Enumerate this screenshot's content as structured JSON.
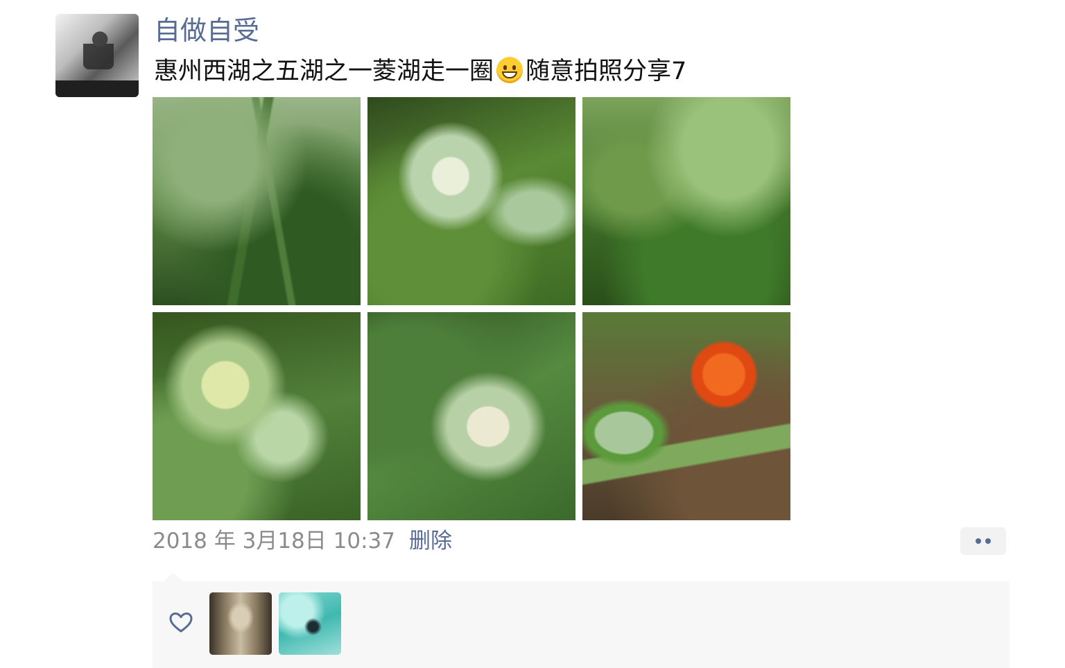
{
  "post": {
    "username": "自做自受",
    "text_before_emoji": "惠州西湖之五湖之一菱湖走一圈",
    "emoji": "grinning-face-emoji",
    "text_after_emoji": "随意拍照分享7",
    "avatar": {
      "icon": "user-avatar-photo"
    },
    "photos": [
      {
        "name": "photo-1",
        "description_icon": "plant-photo"
      },
      {
        "name": "photo-2",
        "description_icon": "plant-photo"
      },
      {
        "name": "photo-3",
        "description_icon": "plant-photo"
      },
      {
        "name": "photo-4",
        "description_icon": "plant-photo"
      },
      {
        "name": "photo-5",
        "description_icon": "plant-photo"
      },
      {
        "name": "photo-6",
        "description_icon": "plant-photo"
      }
    ],
    "timestamp": "2018 年 3月18日 10:37",
    "delete_label": "删除",
    "more_icon": "more-dots-icon"
  },
  "likes": {
    "heart_icon": "heart-icon",
    "likers": [
      {
        "name": "liker-1",
        "icon": "avatar-photo"
      },
      {
        "name": "liker-2",
        "icon": "avatar-photo"
      }
    ]
  },
  "colors": {
    "link": "#576b95",
    "text": "#111111",
    "meta": "#8b8b8b",
    "panel": "#f7f7f7"
  }
}
